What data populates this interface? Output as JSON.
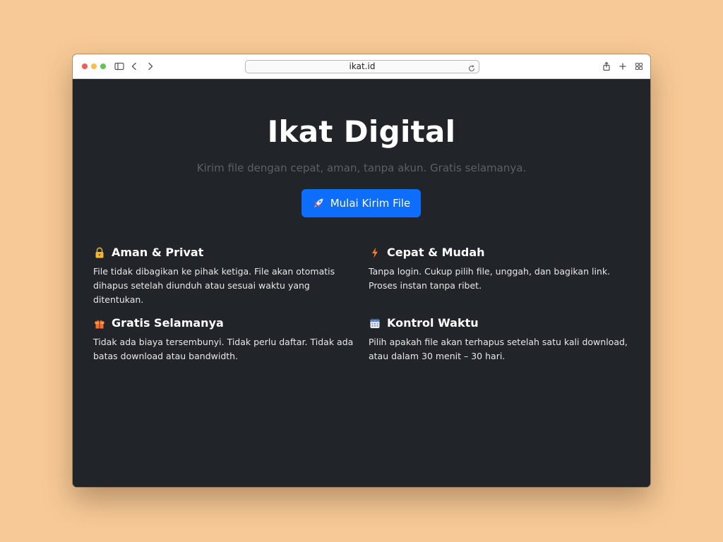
{
  "browser": {
    "url": "ikat.id"
  },
  "hero": {
    "title": "Ikat Digital",
    "subtitle": "Kirim file dengan cepat, aman, tanpa akun. Gratis selamanya.",
    "cta_label": "Mulai Kirim File",
    "cta_icon": "rocket-icon",
    "cta_color": "#0d6efd"
  },
  "features": [
    {
      "icon": "lock-icon",
      "title": "Aman & Privat",
      "text": "File tidak dibagikan ke pihak ketiga. File akan otomatis dihapus setelah diunduh atau sesuai waktu yang ditentukan."
    },
    {
      "icon": "lightning-icon",
      "title": "Cepat & Mudah",
      "text": "Tanpa login. Cukup pilih file, unggah, dan bagikan link. Proses instan tanpa ribet."
    },
    {
      "icon": "gift-icon",
      "title": "Gratis Selamanya",
      "text": "Tidak ada biaya tersembunyi. Tidak perlu daftar. Tidak ada batas download atau bandwidth."
    },
    {
      "icon": "calendar-icon",
      "title": "Kontrol Waktu",
      "text": "Pilih apakah file akan terhapus setelah satu kali download, atau dalam 30 menit – 30 hari."
    }
  ],
  "colors": {
    "page_background": "#212429",
    "accent": "#0d6efd",
    "desktop": "#f7c996"
  }
}
